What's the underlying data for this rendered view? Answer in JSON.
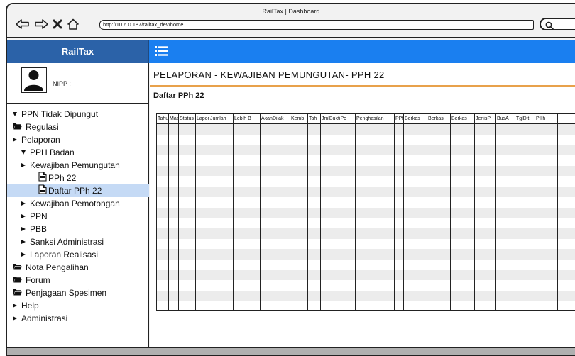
{
  "window": {
    "title": "RailTax | Dashboard",
    "url": "http://10.6.0.187/railtax_dev/home"
  },
  "app": {
    "brand": "RailTax",
    "nipp_label": "NIPP :"
  },
  "sidebar": {
    "items": [
      {
        "label": "PPN Tidak Dipungut",
        "icon": "caret-down"
      },
      {
        "label": "Regulasi",
        "icon": "folder"
      },
      {
        "label": "Pelaporan",
        "icon": "caret-right"
      },
      {
        "label": "PPH Badan",
        "icon": "caret-down"
      },
      {
        "label": "Kewajiban Pemungutan",
        "icon": "caret-right"
      },
      {
        "label": "PPh 22",
        "icon": "document"
      },
      {
        "label": "Daftar PPh 22",
        "icon": "document",
        "selected": true
      },
      {
        "label": "Kewajiban Pemotongan",
        "icon": "caret-right"
      },
      {
        "label": "PPN",
        "icon": "caret-right"
      },
      {
        "label": "PBB",
        "icon": "caret-right"
      },
      {
        "label": "Sanksi Administrasi",
        "icon": "caret-right"
      },
      {
        "label": "Laporan Realisasi",
        "icon": "caret-right"
      },
      {
        "label": "Nota Pengalihan",
        "icon": "folder"
      },
      {
        "label": "Forum",
        "icon": "folder"
      },
      {
        "label": "Penjagaan Spesimen",
        "icon": "folder"
      },
      {
        "label": "Help",
        "icon": "caret-right"
      },
      {
        "label": "Administrasi",
        "icon": "caret-right"
      }
    ]
  },
  "main": {
    "title": "PELAPORAN - KEWAJIBAN PEMUNGUTAN- PPH 22",
    "subtitle": "Daftar PPh 22",
    "table": {
      "columns": [
        "Tahun",
        "Masa",
        "Status",
        "Lapor",
        "Jumlah",
        "Lebih B",
        "AkanDilak",
        "Kemb",
        "Tah",
        "JmlBuktiPo",
        "Penghasilan",
        "PPh",
        "Berkas",
        "Berkas",
        "Berkas",
        "JenisP",
        "BusA",
        "TglDit",
        "Pilih"
      ],
      "row_count": 18
    }
  },
  "colors": {
    "brand_bar": "#2b62a8",
    "top_bar": "#1a7ff0",
    "selected_item": "#c5daf5",
    "title_rule": "#e8a14b"
  }
}
